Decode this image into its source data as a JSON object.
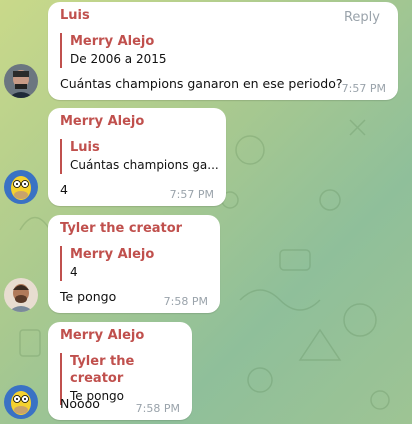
{
  "messages": [
    {
      "sender": "Luis",
      "reply_label": "Reply",
      "quote_name": "Merry Alejo",
      "quote_text": "De 2006 a 2015",
      "text": "Cuántas champions ganaron en ese periodo?",
      "time": "7:57 PM",
      "avatar_icon": "user-photo-icon"
    },
    {
      "sender": "Merry Alejo",
      "quote_name": "Luis",
      "quote_text": "Cuántas champions ga...",
      "text": "4",
      "time": "7:57 PM",
      "avatar_icon": "homer-avatar-icon"
    },
    {
      "sender": "Tyler the creator",
      "quote_name": "Merry Alejo",
      "quote_text": "4",
      "text": "Te pongo",
      "time": "7:58 PM",
      "avatar_icon": "user-photo-icon"
    },
    {
      "sender": "Merry Alejo",
      "quote_name": "Tyler the creator",
      "quote_text": "Te pongo",
      "text": "Noooo",
      "time": "7:58 PM",
      "avatar_icon": "homer-avatar-icon"
    }
  ],
  "colors": {
    "accent": "#c0504d",
    "bubble": "#ffffff",
    "timestamp": "#9aa3ab"
  }
}
